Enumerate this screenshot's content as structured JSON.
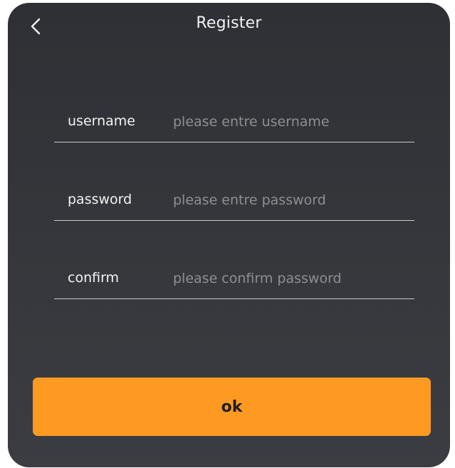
{
  "header": {
    "title": "Register",
    "back_icon": "chevron-left-icon"
  },
  "form": {
    "username": {
      "label": "username",
      "value": "",
      "placeholder": "please entre username"
    },
    "password": {
      "label": "password",
      "value": "",
      "placeholder": "please entre password"
    },
    "confirm": {
      "label": "confirm",
      "value": "",
      "placeholder": "please confirm password"
    }
  },
  "actions": {
    "ok_label": "ok"
  },
  "colors": {
    "accent": "#fe9a22",
    "panel_background": "#34363b",
    "text": "#f4f4f4",
    "placeholder": "#8e8f93",
    "divider": "#c9c9cb"
  }
}
